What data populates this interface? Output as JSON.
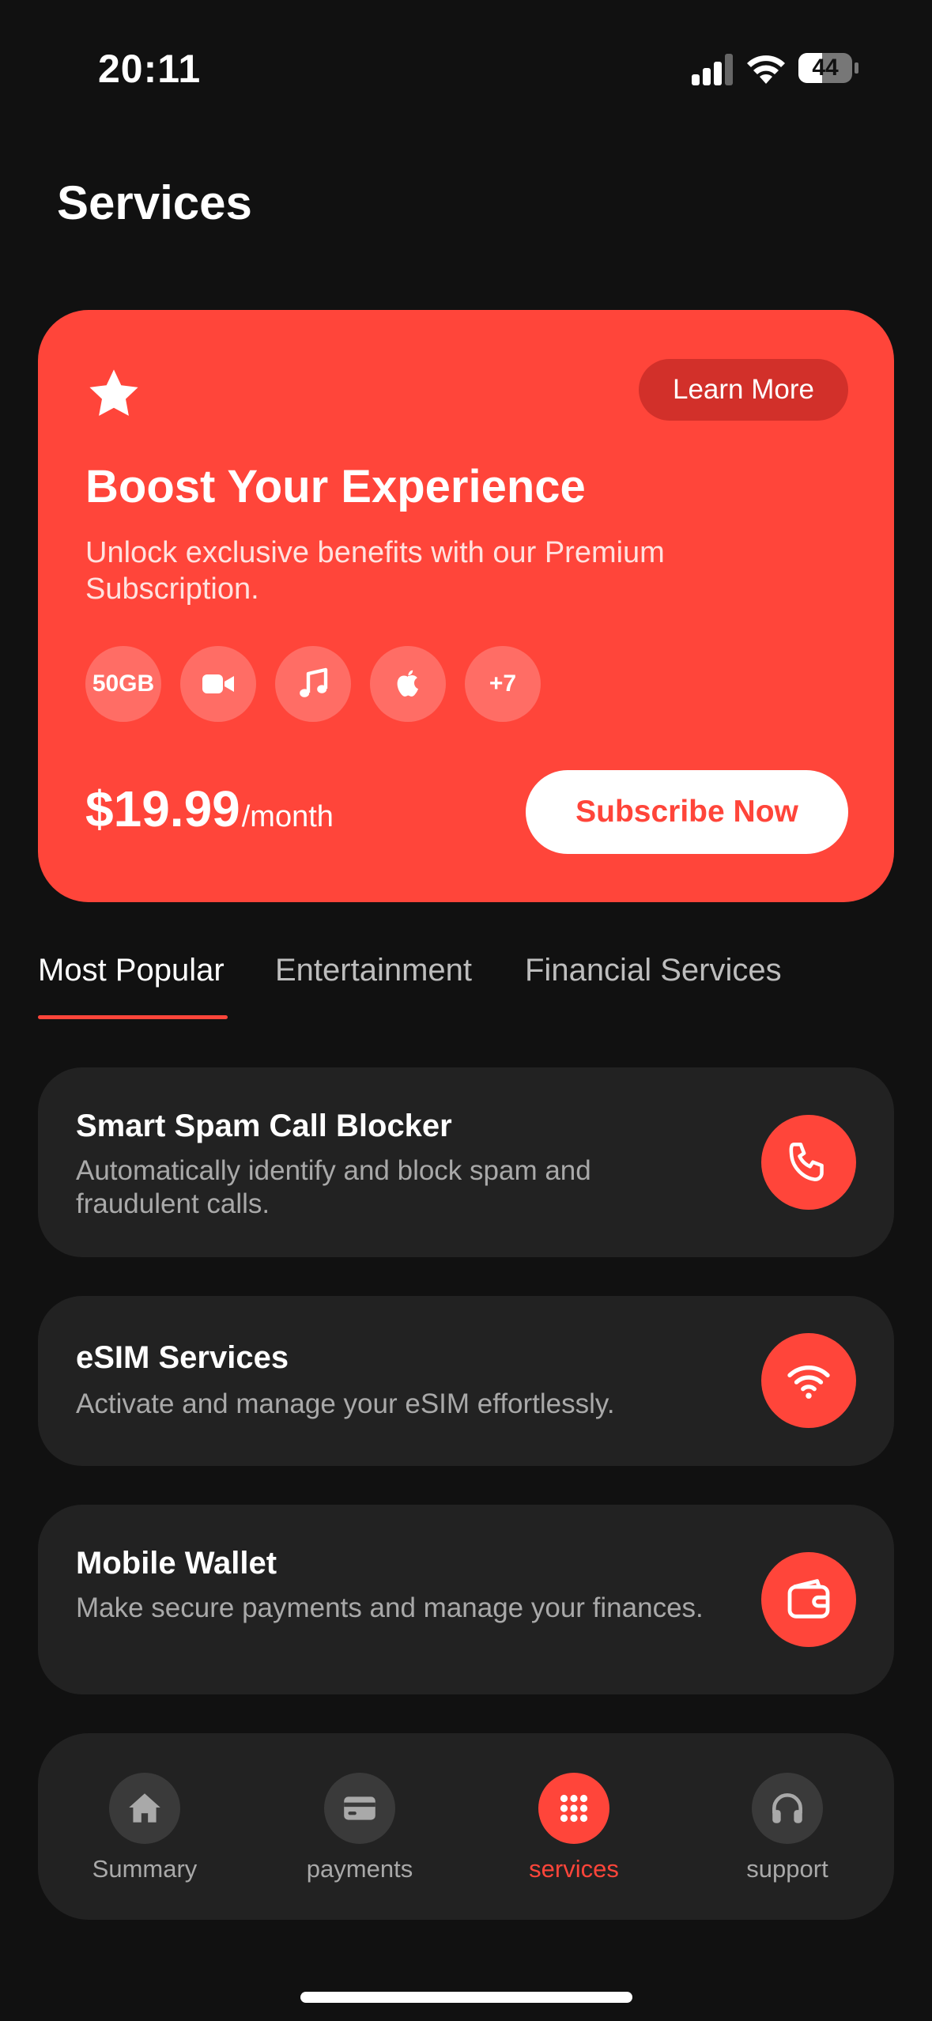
{
  "status_bar": {
    "time": "20:11",
    "battery": "44"
  },
  "page": {
    "title": "Services"
  },
  "promo": {
    "learn_more": "Learn More",
    "title": "Boost Your Experience",
    "description": "Unlock exclusive benefits with our Premium Subscription.",
    "benefits": [
      "50GB",
      "video-icon",
      "music-icon",
      "apple-icon",
      "+7"
    ],
    "benefit_data": "50GB",
    "benefit_more": "+7",
    "price": "$19.99",
    "price_period": "/month",
    "subscribe": "Subscribe Now",
    "color": "#FF453A"
  },
  "tabs": [
    {
      "label": "Most Popular",
      "active": true
    },
    {
      "label": "Entertainment",
      "active": false
    },
    {
      "label": "Financial Services",
      "active": false
    }
  ],
  "services": [
    {
      "title": "Smart Spam Call Blocker",
      "description": "Automatically identify and block spam and fraudulent calls.",
      "icon": "phone-icon"
    },
    {
      "title": "eSIM Services",
      "description": "Activate and manage your eSIM effortlessly.",
      "icon": "wifi-icon"
    },
    {
      "title": "Mobile Wallet",
      "description": "Make secure payments and manage your finances.",
      "icon": "wallet-icon"
    }
  ],
  "nav": [
    {
      "label": "Summary",
      "icon": "home-icon",
      "active": false
    },
    {
      "label": "payments",
      "icon": "card-icon",
      "active": false
    },
    {
      "label": "services",
      "icon": "grid-icon",
      "active": true
    },
    {
      "label": "support",
      "icon": "headphones-icon",
      "active": false
    }
  ],
  "colors": {
    "background": "#111111",
    "card": "#222222",
    "accent": "#FF453A"
  }
}
